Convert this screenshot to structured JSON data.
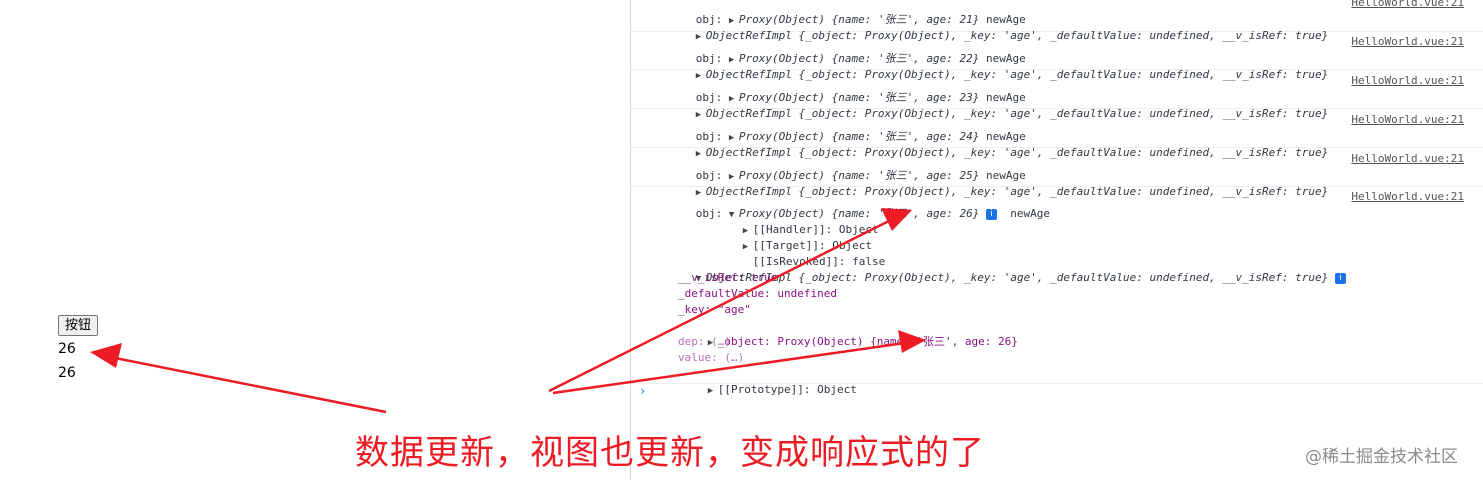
{
  "app": {
    "button_label": "按钮",
    "values": [
      "26",
      "26"
    ]
  },
  "console": {
    "source": "HelloWorld.vue:21",
    "entries": [
      {
        "obj_prefix": "obj: ",
        "proxy_text": "Proxy(Object) {name: '张三', age: 21}",
        "suffix": "newAge",
        "ref_text": "ObjectRefImpl {_object: Proxy(Object), _key: 'age', _defaultValue: undefined, __v_isRef: true}"
      },
      {
        "obj_prefix": "obj: ",
        "proxy_text": "Proxy(Object) {name: '张三', age: 22}",
        "suffix": "newAge",
        "ref_text": "ObjectRefImpl {_object: Proxy(Object), _key: 'age', _defaultValue: undefined, __v_isRef: true}"
      },
      {
        "obj_prefix": "obj: ",
        "proxy_text": "Proxy(Object) {name: '张三', age: 23}",
        "suffix": "newAge",
        "ref_text": "ObjectRefImpl {_object: Proxy(Object), _key: 'age', _defaultValue: undefined, __v_isRef: true}"
      },
      {
        "obj_prefix": "obj: ",
        "proxy_text": "Proxy(Object) {name: '张三', age: 24}",
        "suffix": "newAge",
        "ref_text": "ObjectRefImpl {_object: Proxy(Object), _key: 'age', _defaultValue: undefined, __v_isRef: true}"
      },
      {
        "obj_prefix": "obj: ",
        "proxy_text": "Proxy(Object) {name: '张三', age: 25}",
        "suffix": "newAge",
        "ref_text": "ObjectRefImpl {_object: Proxy(Object), _key: 'age', _defaultValue: undefined, __v_isRef: true}"
      }
    ],
    "expanded": {
      "obj_prefix": "obj: ",
      "proxy_text": "Proxy(Object) {name: '张三', age: 26}",
      "suffix": "newAge",
      "handler": "[[Handler]]: Object",
      "target": "[[Target]]: Object",
      "revoked": "[[IsRevoked]]: false",
      "ref_text": "ObjectRefImpl {_object: Proxy(Object), _key: 'age', _defaultValue: undefined, __v_isRef: true}",
      "props": {
        "v_isref": "__v_isRef: true",
        "default_value": "_defaultValue: undefined",
        "key": "_key: \"age\"",
        "object": "_object: Proxy(Object) {name: '张三', age: 26}",
        "dep": "dep: (…)",
        "value": "value: (…)",
        "prototype": "[[Prototype]]: Object"
      }
    },
    "prompt": "›"
  },
  "annotation": {
    "caption": "数据更新，视图也更新，变成响应式的了",
    "color": "#ec1c24"
  },
  "watermark": "@稀土掘金技术社区"
}
